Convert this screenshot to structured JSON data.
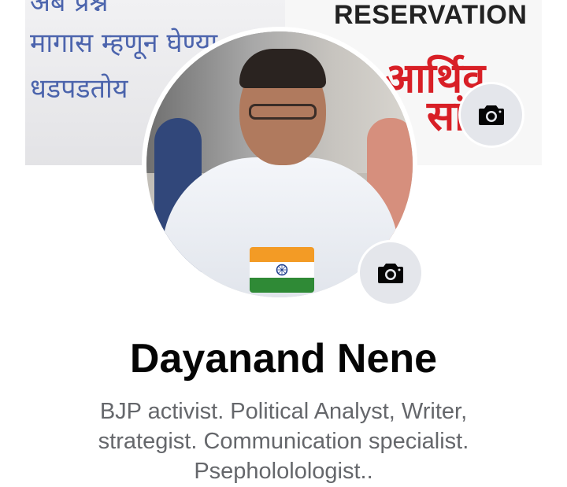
{
  "cover": {
    "left_text_lines": [
      "अब प्रश्न",
      "मागास म्हणून घेण्या",
      "धडपडतोय"
    ],
    "right_headline": "RESERVATION",
    "right_hindi_line1": "र आर्थिव",
    "right_hindi_line2": "सां"
  },
  "buttons": {
    "cover_camera_icon": "camera-icon",
    "profile_camera_icon": "camera-icon"
  },
  "profile": {
    "name": "Dayanand Nene",
    "bio": "BJP activist. Political Analyst, Writer, strategist. Communication specialist. Psephololologist.."
  },
  "colors": {
    "bio_text": "#65676b",
    "name_text": "#050505",
    "camera_button_bg": "#e4e6eb",
    "flag_saffron": "#f39b25",
    "flag_green": "#2f8a36"
  }
}
